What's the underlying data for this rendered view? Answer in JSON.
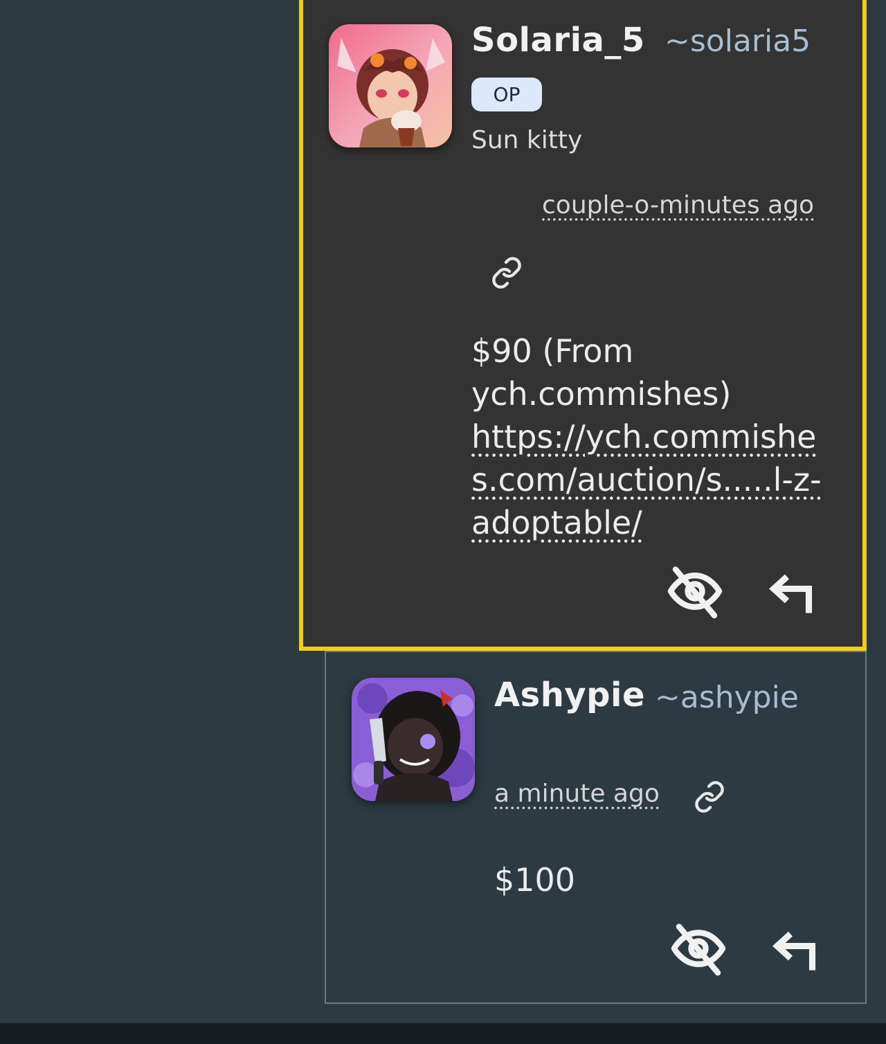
{
  "comments": [
    {
      "username": "Solaria_5",
      "handle": "~solaria5",
      "badge": "OP",
      "subtitle": "Sun kitty",
      "timestamp": "couple-o-minutes ago",
      "text": "$90 (From ych.commishes)",
      "link_text": "https://ych.commishes.com/auction/s.....l-z-adoptable/",
      "highlighted": true,
      "highlight_color": "#f2cd1b"
    },
    {
      "username": "Ashypie",
      "handle": "~ashypie",
      "timestamp": "a minute ago",
      "text": "$100",
      "highlighted": false
    }
  ],
  "icons": {
    "permalink": "link-icon",
    "hide": "eye-off-icon",
    "reply": "reply-arrow-icon"
  },
  "colors": {
    "background": "#2d3a41",
    "highlighted_card": "#333333",
    "handle": "#a9bdd0",
    "badge_bg": "#dde8fb"
  }
}
